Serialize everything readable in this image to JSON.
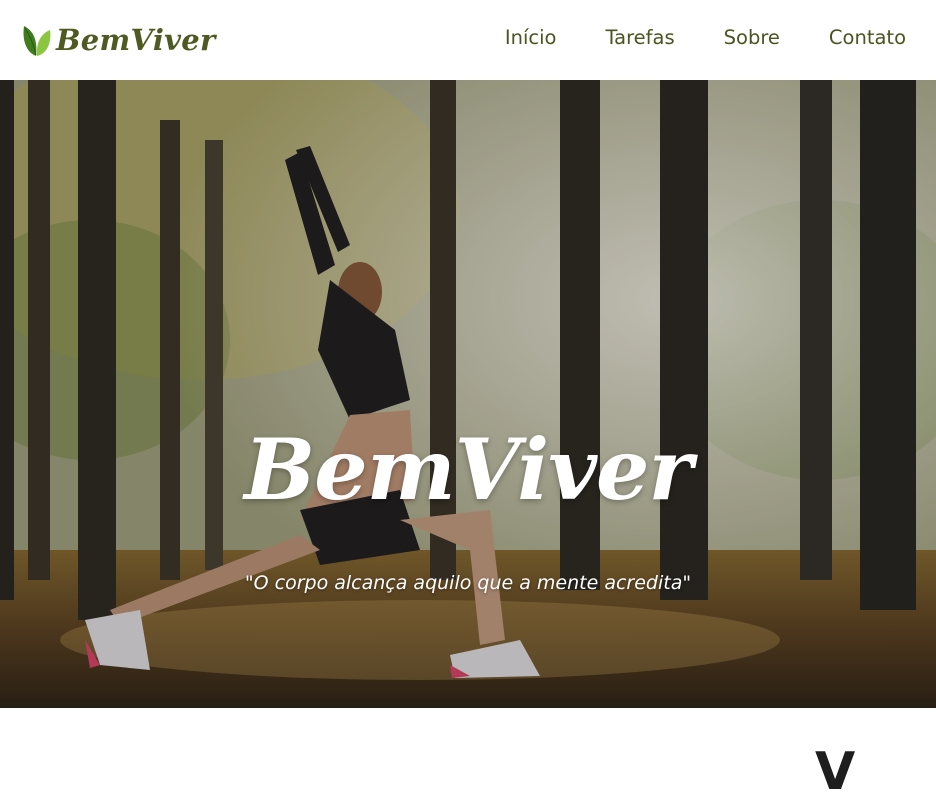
{
  "brand": {
    "name": "BemViver",
    "logo_icon": "leaf-icon",
    "colors": {
      "primary": "#4f5a22",
      "leaf_dark": "#3f7d1f",
      "leaf_light": "#8cc63f"
    }
  },
  "nav": {
    "items": [
      {
        "label": "Início"
      },
      {
        "label": "Tarefas"
      },
      {
        "label": "Sobre"
      },
      {
        "label": "Contato"
      }
    ]
  },
  "hero": {
    "title": "BemViver",
    "quote": "\"O corpo alcança aquilo que a mente acredita\""
  },
  "next_section": {
    "partial_heading": "V"
  }
}
